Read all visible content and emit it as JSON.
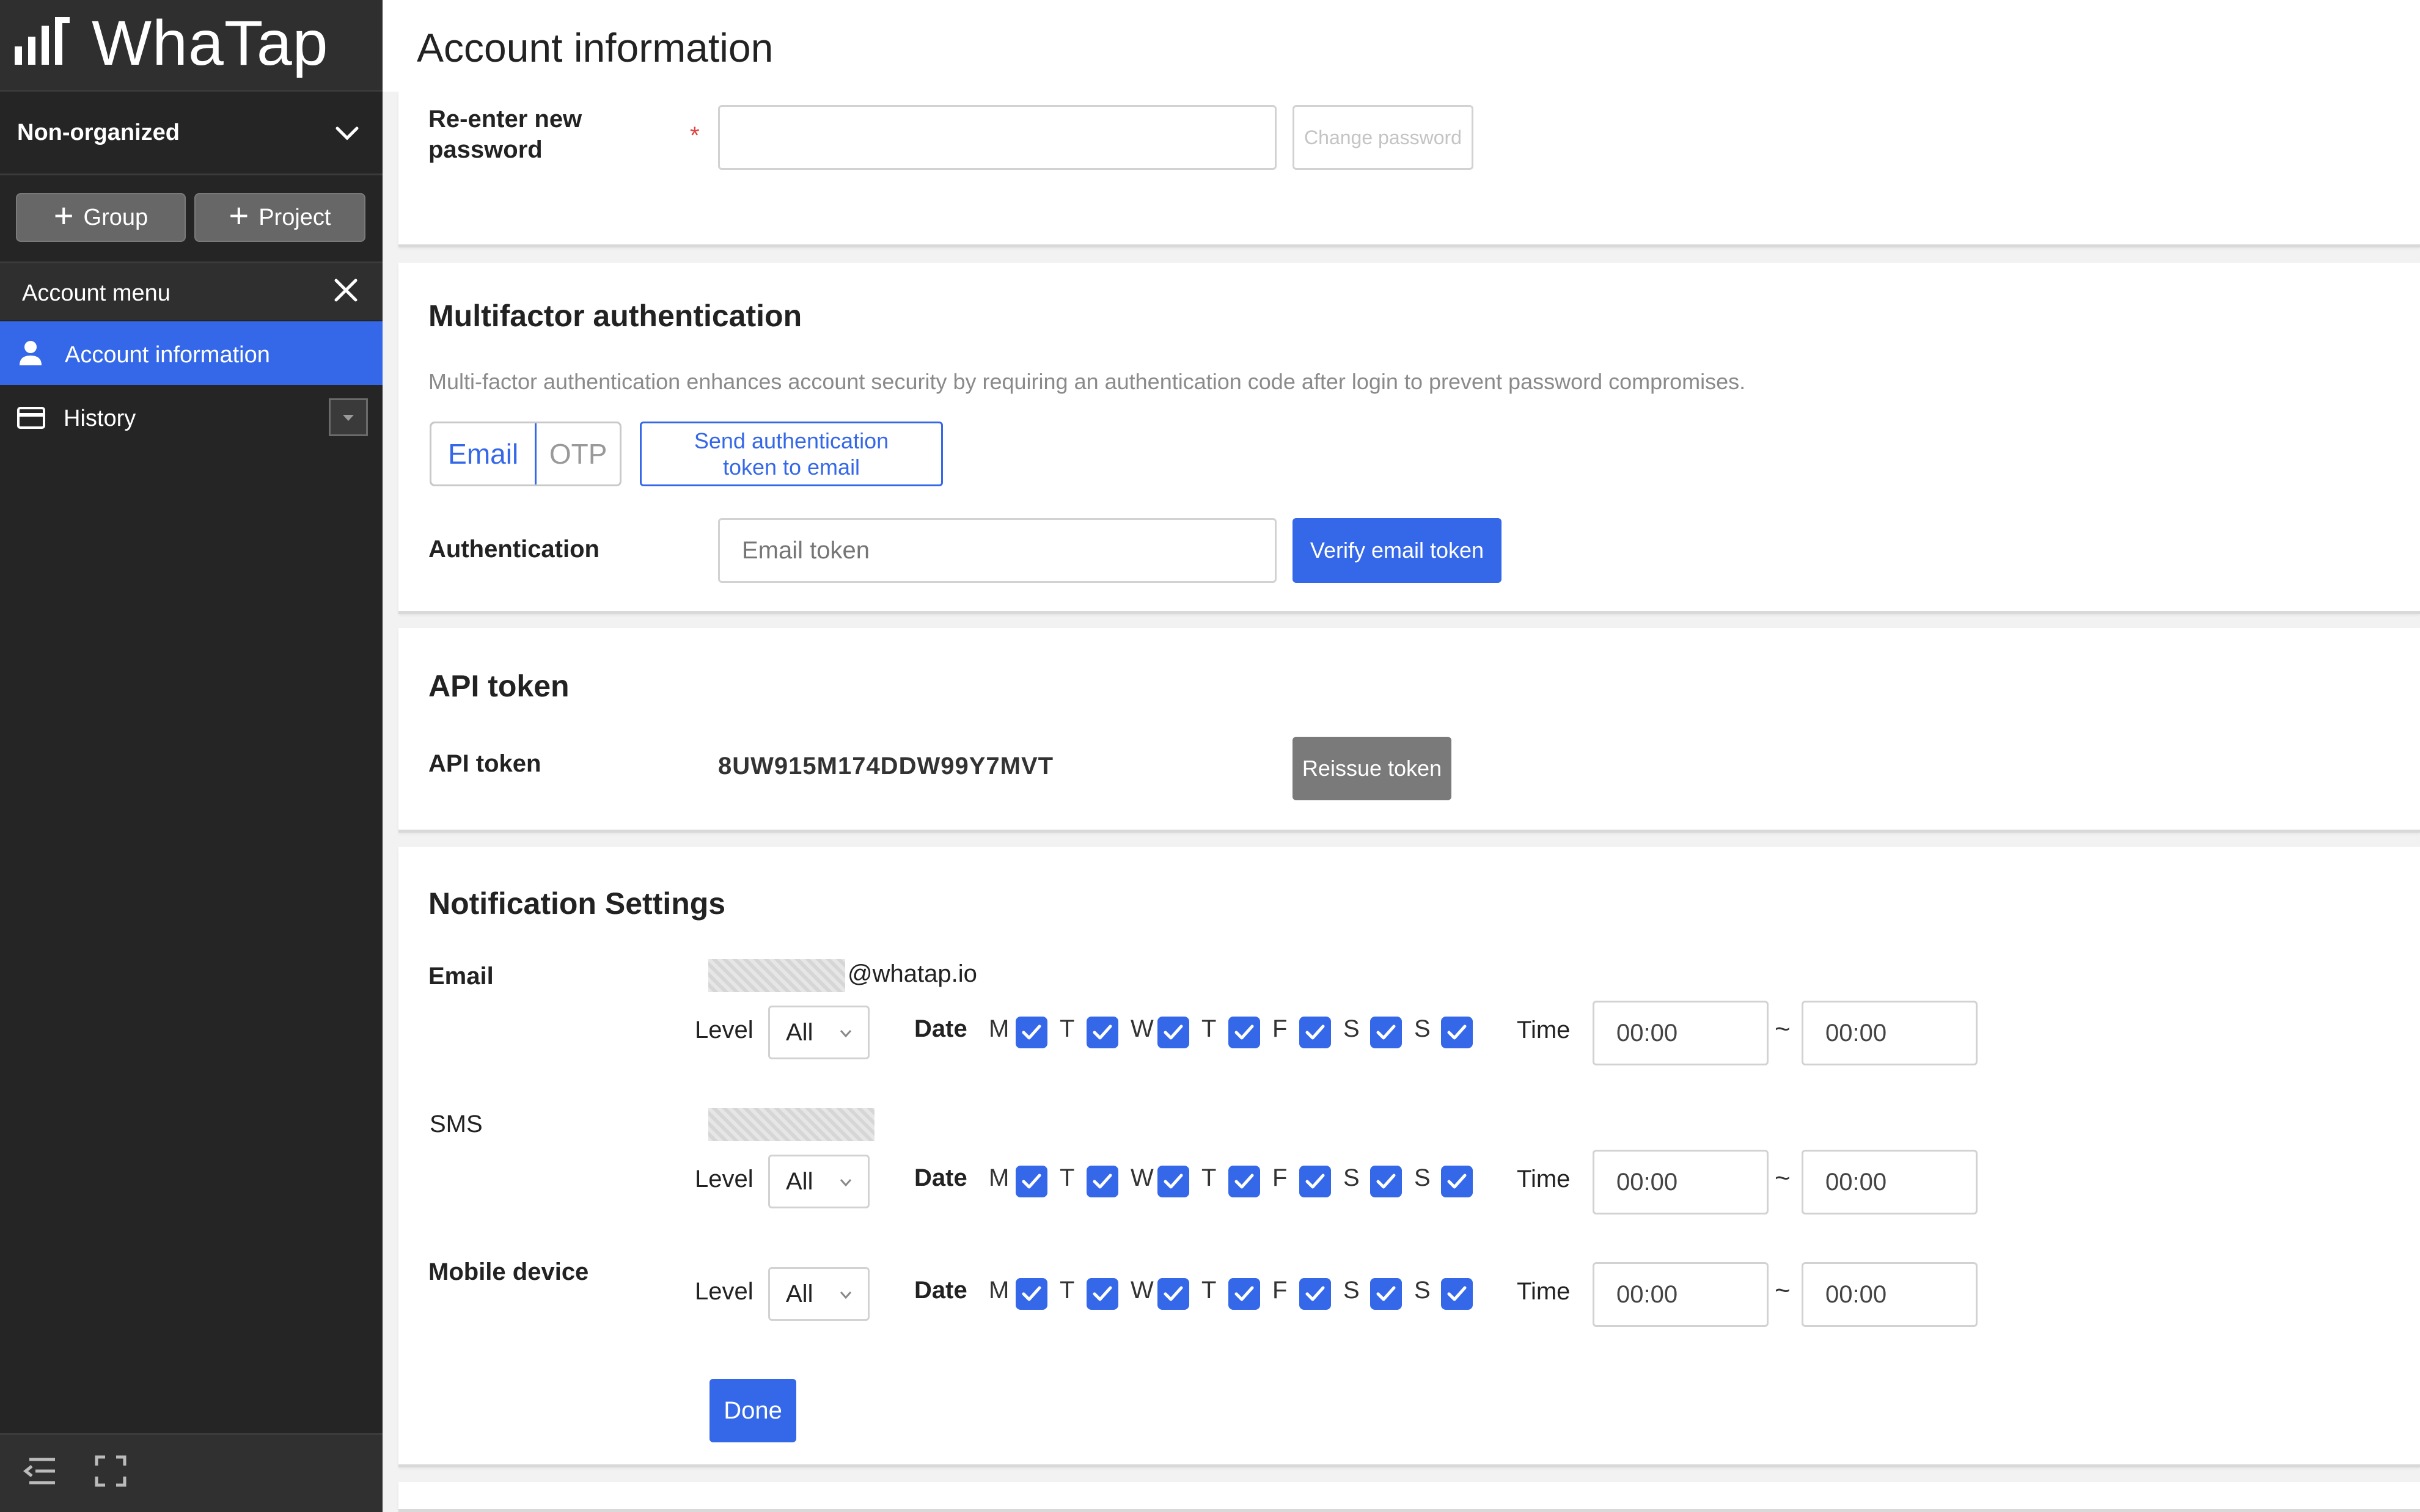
{
  "app": {
    "name": "WhaTap"
  },
  "sidebar": {
    "organization": "Non-organized",
    "buttons": {
      "group": "Group",
      "project": "Project"
    },
    "menu_title": "Account menu",
    "items": [
      {
        "label": "Account information",
        "active": true
      },
      {
        "label": "History",
        "active": false
      }
    ]
  },
  "header": {
    "title": "Account information"
  },
  "password": {
    "reenter_label": "Re-enter new password",
    "required_mark": "*",
    "reenter_value": "",
    "change_button": "Change password"
  },
  "mfa": {
    "title": "Multifactor authentication",
    "description": "Multi-factor authentication enhances account security by requiring an authentication code after login to prevent password compromises.",
    "methods": [
      "Email",
      "OTP"
    ],
    "selected_method": "Email",
    "send_button": "Send authentication token to email",
    "auth_label": "Authentication",
    "token_placeholder": "Email token",
    "verify_button": "Verify email token"
  },
  "api": {
    "title": "API token",
    "label": "API token",
    "value": "8UW915M174DDW99Y7MVT",
    "reissue_button": "Reissue token"
  },
  "notifications": {
    "title": "Notification Settings",
    "level_label": "Level",
    "date_label": "Date",
    "time_label": "Time",
    "tilde": "~",
    "days": [
      "M",
      "T",
      "W",
      "T",
      "F",
      "S",
      "S"
    ],
    "rows": [
      {
        "label": "Email",
        "address": "@whatap.io",
        "level": "All",
        "time_from": "00:00",
        "time_to": "00:00"
      },
      {
        "label": "SMS",
        "level": "All",
        "time_from": "00:00",
        "time_to": "00:00"
      },
      {
        "label": "Mobile device",
        "level": "All",
        "time_from": "00:00",
        "time_to": "00:00"
      }
    ],
    "done_button": "Done"
  },
  "colors": {
    "accent": "#3568e8",
    "sidebar": "#252525",
    "required": "#e04040"
  }
}
